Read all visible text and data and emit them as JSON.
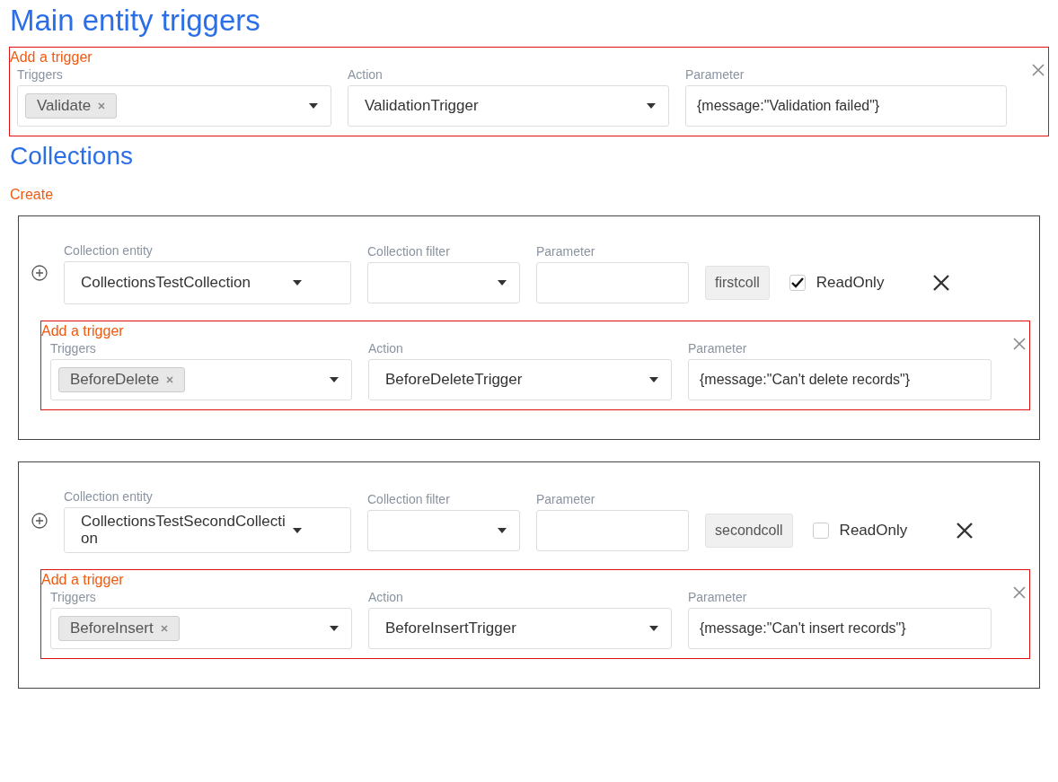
{
  "title": "Main entity triggers",
  "main_trigger": {
    "heading": "Add a trigger",
    "triggers_label": "Triggers",
    "triggers": [
      "Validate"
    ],
    "action_label": "Action",
    "action": "ValidationTrigger",
    "parameter_label": "Parameter",
    "parameter": "{message:\"Validation failed\"}"
  },
  "collections_heading": "Collections",
  "create_link": "Create",
  "collections": [
    {
      "entity_label": "Collection entity",
      "entity": "CollectionsTestCollection",
      "filter_label": "Collection filter",
      "parameter_label": "Parameter",
      "alias": "firstcoll",
      "readonly_label": "ReadOnly",
      "readonly": true,
      "trigger": {
        "heading": "Add a trigger",
        "triggers_label": "Triggers",
        "triggers": [
          "BeforeDelete"
        ],
        "action_label": "Action",
        "action": "BeforeDeleteTrigger",
        "parameter_label": "Parameter",
        "parameter": "{message:\"Can't delete records\"}"
      }
    },
    {
      "entity_label": "Collection entity",
      "entity": "CollectionsTestSecondCollection",
      "filter_label": "Collection filter",
      "parameter_label": "Parameter",
      "alias": "secondcoll",
      "readonly_label": "ReadOnly",
      "readonly": false,
      "trigger": {
        "heading": "Add a trigger",
        "triggers_label": "Triggers",
        "triggers": [
          "BeforeInsert"
        ],
        "action_label": "Action",
        "action": "BeforeInsertTrigger",
        "parameter_label": "Parameter",
        "parameter": "{message:\"Can't insert records\"}"
      }
    }
  ]
}
